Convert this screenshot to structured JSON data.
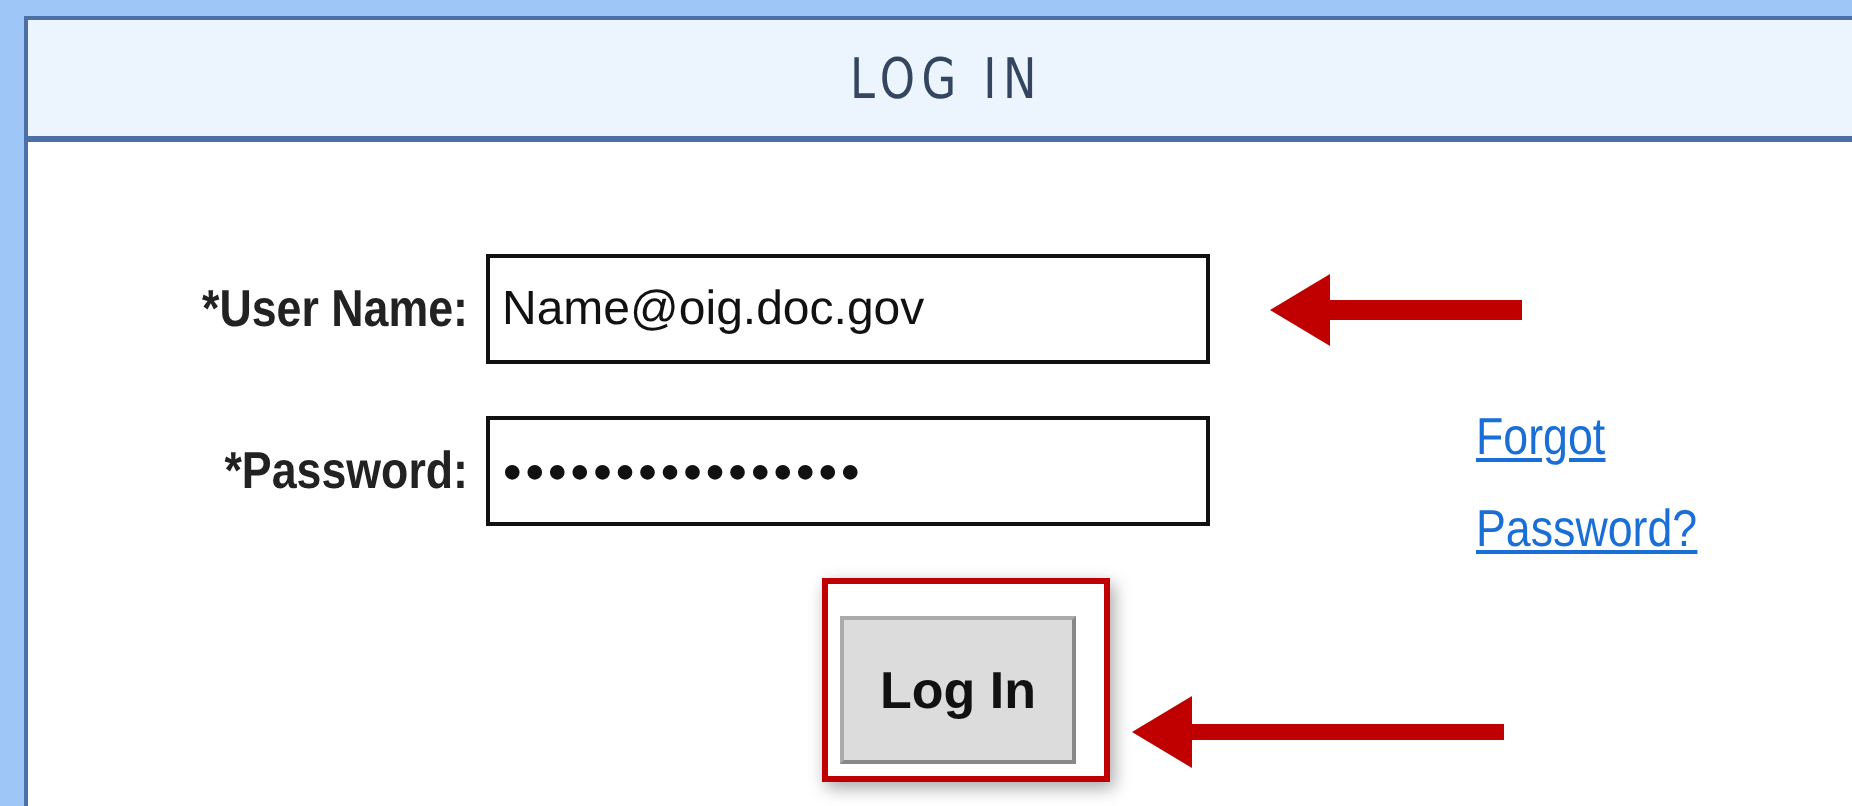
{
  "panel": {
    "title": "LOG IN"
  },
  "fields": [
    {
      "label": "*User Name:",
      "value": "Name@oig.doc.gov",
      "kind": "text"
    },
    {
      "label": "*Password:",
      "value": "●●●●●●●●●●●●●●●●",
      "kind": "password"
    }
  ],
  "forgot_link": {
    "lines": [
      "Forgot",
      "Password?"
    ]
  },
  "login_button": {
    "label": "Log In"
  }
}
